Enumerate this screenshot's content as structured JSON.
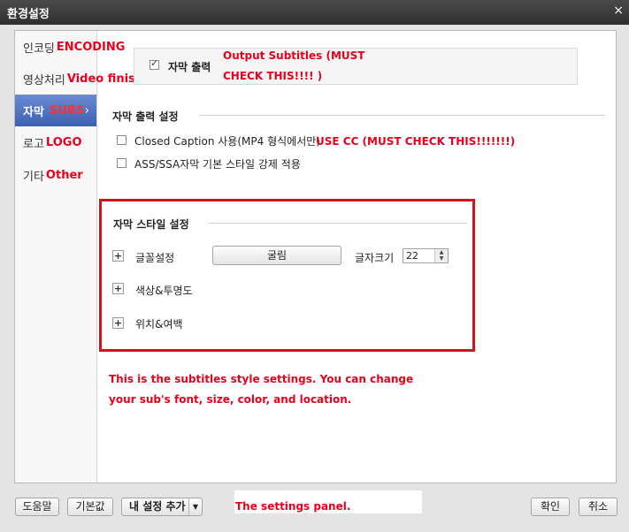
{
  "window": {
    "title": "환경설정"
  },
  "sidebar": {
    "items": [
      {
        "label": "인코딩",
        "annotation": "ENCODING",
        "active": false
      },
      {
        "label": "영상처리",
        "annotation": "Video finish",
        "active": false
      },
      {
        "label": "자막",
        "annotation": "SUBS",
        "active": true
      },
      {
        "label": "로고",
        "annotation": "LOGO",
        "active": false
      },
      {
        "label": "기타",
        "annotation": "Other",
        "active": false
      }
    ]
  },
  "subtitle_output": {
    "checkbox_label": "자막 출력",
    "checked": true,
    "annotation_line1": "Output Subtitles (MUST",
    "annotation_line2": "CHECK THIS!!!! )"
  },
  "output_settings": {
    "heading": "자막 출력 설정",
    "closed_caption_label": "Closed Caption 사용(MP4 형식에서만)",
    "closed_caption_annotation": "USE CC (MUST CHECK THIS!!!!!!!)",
    "ass_label": "ASS/SSA자막 기본 스타일 강제 적용"
  },
  "style_settings": {
    "heading": "자막 스타일 설정",
    "font_label": "글꼴설정",
    "font_button": "굴림",
    "size_label": "글자크기",
    "size_value": "22",
    "color_label": "색상&투명도",
    "position_label": "위치&여백"
  },
  "annotations": {
    "style_note_line1": "This is the subtitles style settings. You can change",
    "style_note_line2": "your sub's font, size, color, and location.",
    "panel_note": "The settings panel."
  },
  "footer": {
    "help": "도움말",
    "defaults": "기본값",
    "add_preset": "내 설정 추가",
    "ok": "확인",
    "cancel": "취소"
  }
}
